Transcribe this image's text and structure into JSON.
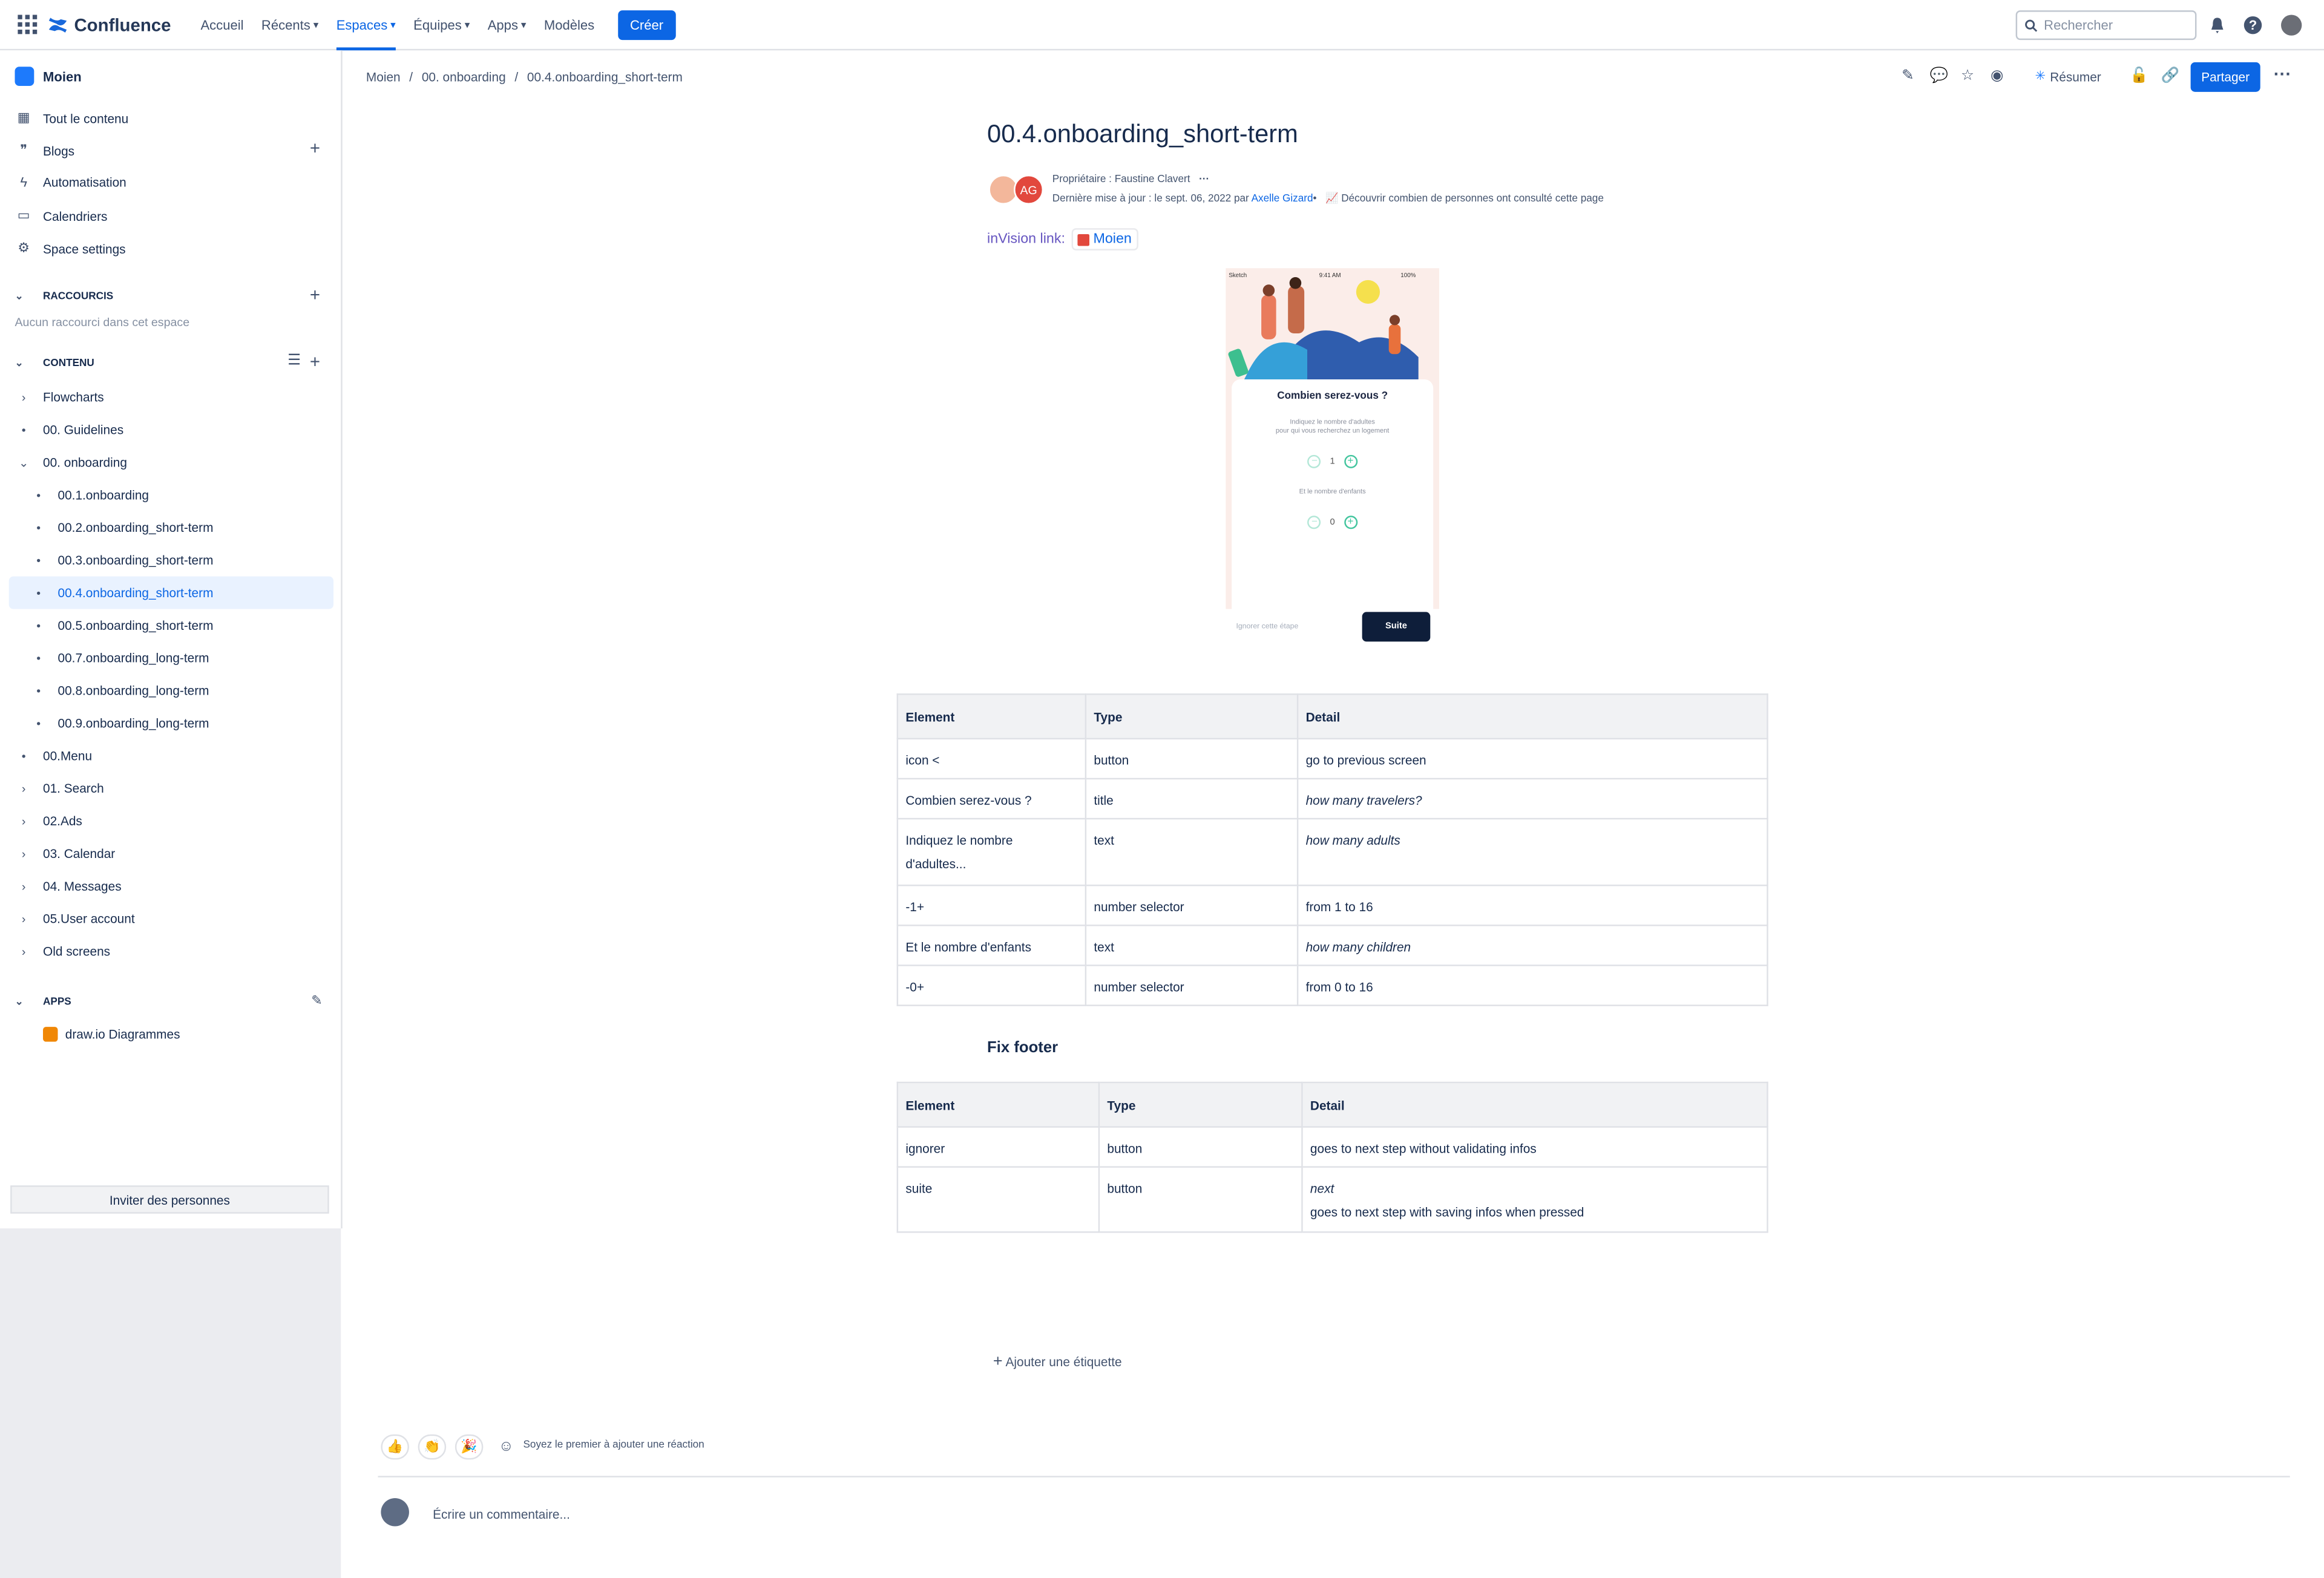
{
  "app": {
    "name": "Confluence"
  },
  "nav": {
    "home": "Accueil",
    "recents": "Récents",
    "spaces": "Espaces",
    "teams": "Équipes",
    "apps": "Apps",
    "templates": "Modèles",
    "create": "Créer"
  },
  "search": {
    "placeholder": "Rechercher"
  },
  "sidebar": {
    "space": "Moien",
    "items": [
      "Tout le contenu",
      "Blogs",
      "Automatisation",
      "Calendriers",
      "Space settings"
    ],
    "shortcuts_title": "RACCOURCIS",
    "shortcuts_empty": "Aucun raccourci dans cet espace",
    "content_title": "CONTENU",
    "tree": [
      "Flowcharts",
      "00. Guidelines",
      "00. onboarding",
      "00.1.onboarding",
      "00.2.onboarding_short-term",
      "00.3.onboarding_short-term",
      "00.4.onboarding_short-term",
      "00.5.onboarding_short-term",
      "00.7.onboarding_long-term",
      "00.8.onboarding_long-term",
      "00.9.onboarding_long-term",
      "00.Menu",
      "01. Search",
      "02.Ads",
      "03. Calendar",
      "04. Messages",
      "05.User account",
      "Old screens"
    ],
    "apps_title": "APPS",
    "apps_item": "draw.io Diagrammes",
    "invite": "Inviter des personnes"
  },
  "breadcrumb": [
    "Moien",
    "00. onboarding",
    "00.4.onboarding_short-term"
  ],
  "toolbar": {
    "summarize": "Résumer",
    "share": "Partager"
  },
  "page": {
    "title": "00.4.onboarding_short-term",
    "owner": "Propriétaire : Faustine Clavert",
    "updated": "Dernière mise à jour : le sept. 06, 2022 par",
    "updated_by": "Axelle Gizard",
    "analytics": "Découvrir combien de personnes ont consulté cette page",
    "avatar_initials": "AG",
    "invision_label": "inVision link:",
    "invision_link": "Moien"
  },
  "mockup": {
    "status_left": "Sketch",
    "status_time": "9:41 AM",
    "status_right": "100%",
    "title": "Combien serez-vous ?",
    "subtitle1": "Indiquez le nombre d'adultes",
    "subtitle2": "pour qui vous recherchez un logement",
    "adults": "1",
    "children_label": "Et le nombre d'enfants",
    "children": "0",
    "skip": "Ignorer cette étape",
    "next": "Suite"
  },
  "table1": {
    "headers": [
      "Element",
      "Type",
      "Detail"
    ],
    "rows": [
      [
        "icon <",
        "button",
        "go to previous screen"
      ],
      [
        "Combien serez-vous ?",
        "title",
        "how many travelers?"
      ],
      [
        "Indiquez le nombre d'adultes...",
        "text",
        "how many adults"
      ],
      [
        "-1+",
        "number selector",
        "from 1 to 16"
      ],
      [
        "Et le nombre d'enfants",
        "text",
        "how many children"
      ],
      [
        "-0+",
        "number selector",
        "from 0 to 16"
      ]
    ]
  },
  "footer_heading": "Fix footer",
  "table2": {
    "headers": [
      "Element",
      "Type",
      "Detail"
    ],
    "rows": [
      [
        "ignorer",
        "button",
        "goes to next step without validating infos"
      ],
      [
        "suite",
        "button",
        "next",
        "goes to next step with saving infos when pressed"
      ]
    ]
  },
  "labels": {
    "add": "Ajouter une étiquette"
  },
  "reactions": {
    "prompt": "Soyez le premier à ajouter une réaction",
    "emojis": [
      "👍",
      "👏",
      "🎉"
    ]
  },
  "comment": {
    "placeholder": "Écrire un commentaire..."
  }
}
